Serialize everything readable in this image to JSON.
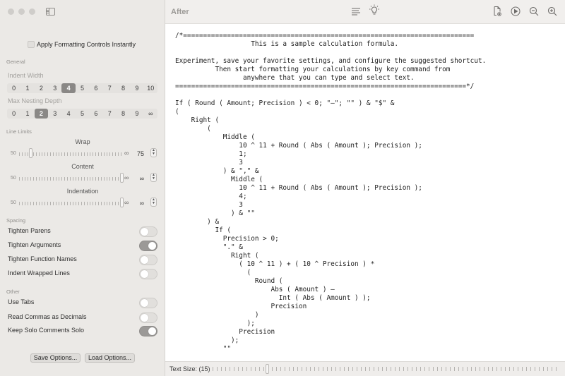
{
  "window": {
    "title": "After"
  },
  "sidebar": {
    "apply_instantly": {
      "label": "Apply Formatting Controls Instantly",
      "checked": false
    },
    "general": {
      "heading": "General",
      "indent_width": {
        "label": "Indent Width",
        "options": [
          "0",
          "1",
          "2",
          "3",
          "4",
          "5",
          "6",
          "7",
          "8",
          "9",
          "10"
        ],
        "selected": "4"
      },
      "max_nesting_depth": {
        "label": "Max Nesting Depth",
        "options": [
          "0",
          "1",
          "2",
          "3",
          "4",
          "5",
          "6",
          "7",
          "8",
          "9",
          "∞"
        ],
        "selected": "2"
      }
    },
    "line_limits": {
      "heading": "Line Limits",
      "wrap": {
        "label": "Wrap",
        "min": "50",
        "max": "∞",
        "value": "75",
        "fraction": 0.1
      },
      "content": {
        "label": "Content",
        "min": "50",
        "max": "∞",
        "value": "∞",
        "fraction": 1.0
      },
      "indentation": {
        "label": "Indentation",
        "min": "50",
        "max": "∞",
        "value": "∞",
        "fraction": 1.0
      }
    },
    "spacing": {
      "heading": "Spacing",
      "toggles": [
        {
          "label": "Tighten Parens",
          "on": false
        },
        {
          "label": "Tighten Arguments",
          "on": true
        },
        {
          "label": "Tighten Function Names",
          "on": false
        },
        {
          "label": "Indent Wrapped Lines",
          "on": false
        }
      ]
    },
    "other": {
      "heading": "Other",
      "toggles": [
        {
          "label": "Use Tabs",
          "on": false
        },
        {
          "label": "Read Commas as Decimals",
          "on": false
        },
        {
          "label": "Keep Solo Comments Solo",
          "on": true
        }
      ]
    },
    "save_options": "Save Options...",
    "load_options": "Load Options..."
  },
  "toolbar_icons": [
    "format-lines-icon",
    "lightbulb-icon",
    "document-settings-icon",
    "play-circle-icon",
    "zoom-out-icon",
    "zoom-in-icon"
  ],
  "editor": {
    "code_lines": [
      "/*=========================================================================",
      "                   This is a sample calculation formula.",
      "",
      "Experiment, save your favorite settings, and configure the suggested shortcut.",
      "          Then start formatting your calculations by key command from",
      "                 anywhere that you can type and select text.",
      "=========================================================================*/",
      "",
      "If ( Round ( Amount; Precision ) < 0; \"–\"; \"\" ) & \"$\" &",
      "(",
      "    Right (",
      "        (",
      "            Middle (",
      "                10 ^ 11 + Round ( Abs ( Amount ); Precision );",
      "                1;",
      "                3",
      "            ) & \",\" &",
      "              Middle (",
      "                10 ^ 11 + Round ( Abs ( Amount ); Precision );",
      "                4;",
      "                3",
      "              ) & \"\"",
      "        ) &",
      "          If (",
      "            Precision > 0;",
      "            \".\" &",
      "              Right (",
      "                ( 10 ^ 11 ) + ( 10 ^ Precision ) *",
      "                  (",
      "                    Round (",
      "                        Abs ( Amount ) –",
      "                          Int ( Abs ( Amount ) );",
      "                        Precision",
      "                    )",
      "                  );",
      "                Precision",
      "              );",
      "            \"\""
    ]
  },
  "statusbar": {
    "text_size_label": "Text Size: (15)"
  }
}
